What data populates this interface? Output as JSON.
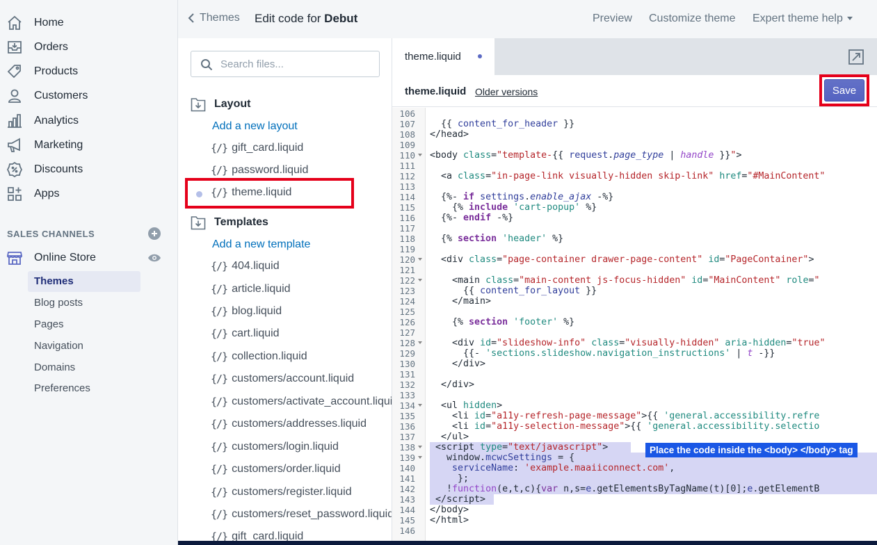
{
  "nav": {
    "items": [
      {
        "label": "Home",
        "icon": "home-icon"
      },
      {
        "label": "Orders",
        "icon": "orders-icon"
      },
      {
        "label": "Products",
        "icon": "tag-icon"
      },
      {
        "label": "Customers",
        "icon": "person-icon"
      },
      {
        "label": "Analytics",
        "icon": "bar-chart-icon"
      },
      {
        "label": "Marketing",
        "icon": "megaphone-icon"
      },
      {
        "label": "Discounts",
        "icon": "discount-icon"
      },
      {
        "label": "Apps",
        "icon": "apps-icon"
      }
    ],
    "sales_channels_title": "SALES CHANNELS",
    "online_store": "Online Store",
    "sub_items": [
      "Themes",
      "Blog posts",
      "Pages",
      "Navigation",
      "Domains",
      "Preferences"
    ]
  },
  "topbar": {
    "back_label": "Themes",
    "title_prefix": "Edit code for ",
    "title_theme": "Debut",
    "preview": "Preview",
    "customize": "Customize theme",
    "expert_help": "Expert theme help"
  },
  "files": {
    "search_placeholder": "Search files...",
    "glyph": "{/}",
    "layout_title": "Layout",
    "add_layout": "Add a new layout",
    "layout_files": [
      "gift_card.liquid",
      "password.liquid",
      "theme.liquid"
    ],
    "templates_title": "Templates",
    "add_template": "Add a new template",
    "template_files": [
      "404.liquid",
      "article.liquid",
      "blog.liquid",
      "cart.liquid",
      "collection.liquid",
      "customers/account.liquid",
      "customers/activate_account.liquid",
      "customers/addresses.liquid",
      "customers/login.liquid",
      "customers/order.liquid",
      "customers/register.liquid",
      "customers/reset_password.liquid",
      "gift_card.liquid"
    ]
  },
  "editor": {
    "tab_name": "theme.liquid",
    "file_name": "theme.liquid",
    "older_versions": "Older versions",
    "save_label": "Save",
    "tooltip": "Place the code inside the <body> </body> tag",
    "line_numbers": [
      "106",
      "107",
      "108",
      "109",
      "110",
      "111",
      "112",
      "113",
      "114",
      "115",
      "116",
      "117",
      "118",
      "119",
      "120",
      "121",
      "122",
      "123",
      "124",
      "125",
      "126",
      "127",
      "128",
      "129",
      "130",
      "131",
      "132",
      "133",
      "134",
      "135",
      "136",
      "137",
      "138",
      "139",
      "140",
      "141",
      "142",
      "143",
      "144",
      "145",
      "146"
    ]
  },
  "colors": {
    "accent": "#5c6ac4",
    "link": "#006fbb",
    "highlight_box": "#e5001a",
    "tooltip_bg": "#1a57e5"
  }
}
